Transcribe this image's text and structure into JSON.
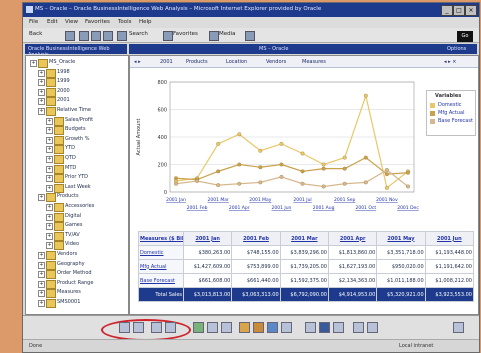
{
  "window": {
    "title": "MS – Oracle – Oracle BusinessIntelligence Web Analysis – Microsoft Internet Explorer provided by Oracle",
    "min": "_",
    "max": "□",
    "close": "×"
  },
  "menu": [
    "File",
    "Edit",
    "View",
    "Favorites",
    "Tools",
    "Help"
  ],
  "toolbar": {
    "back": "Back",
    "search": "Search",
    "favorites": "Favorites",
    "media": "Media",
    "address_btn": "Go"
  },
  "left_panel": {
    "header": "Oracle BusinessIntelligence Web Analysis"
  },
  "right_panel": {
    "header": "MS – Oracle",
    "right_label": "Options"
  },
  "tree": [
    {
      "label": "MS_Oracle",
      "level": 0
    },
    {
      "label": "1998",
      "level": 1
    },
    {
      "label": "1999",
      "level": 1
    },
    {
      "label": "2000",
      "level": 1
    },
    {
      "label": "2001",
      "level": 1
    },
    {
      "label": "Relative Time",
      "level": 1
    },
    {
      "label": "Sales/Profit",
      "level": 2
    },
    {
      "label": "Budgets",
      "level": 2
    },
    {
      "label": "Growth %",
      "level": 2
    },
    {
      "label": "YTD",
      "level": 2
    },
    {
      "label": "QTD",
      "level": 2
    },
    {
      "label": "MTD",
      "level": 2
    },
    {
      "label": "Prior YTD",
      "level": 2
    },
    {
      "label": "Last Week",
      "level": 2
    },
    {
      "label": "Products",
      "level": 1
    },
    {
      "label": "Accessories",
      "level": 2
    },
    {
      "label": "Digital",
      "level": 2
    },
    {
      "label": "Games",
      "level": 2
    },
    {
      "label": "TV/AV",
      "level": 2
    },
    {
      "label": "Video",
      "level": 2
    },
    {
      "label": "Vendors",
      "level": 1
    },
    {
      "label": "Geography",
      "level": 1
    },
    {
      "label": "Order Method",
      "level": 1
    },
    {
      "label": "Product Range",
      "level": 1
    },
    {
      "label": "Measures",
      "level": 1
    },
    {
      "label": "SMS0001",
      "level": 1
    }
  ],
  "dimbar": [
    "2001",
    "Products",
    "Location",
    "Vendors",
    "Measures"
  ],
  "chart_data": {
    "type": "line",
    "categories": [
      "2001 Jan",
      "2001 Feb",
      "2001 Mar",
      "2001 Apr",
      "2001 May",
      "2001 Jun",
      "2001 Jul",
      "2001 Aug",
      "2001 Sep",
      "2001 Oct",
      "2001 Nov",
      "2001 Dec"
    ],
    "ylim": [
      0,
      800
    ],
    "yticks": [
      "800",
      "600",
      "400",
      "200",
      "0"
    ],
    "ylabel": "Actual Amount",
    "grid": true,
    "legend": "right",
    "legend_title": "Variables",
    "series": [
      {
        "name": "Domestic",
        "color": "#e8c86a",
        "values": [
          80,
          100,
          350,
          420,
          300,
          350,
          280,
          200,
          250,
          700,
          30,
          150
        ]
      },
      {
        "name": "Mfg Actual",
        "color": "#c9a24c",
        "values": [
          100,
          90,
          150,
          200,
          180,
          200,
          150,
          170,
          170,
          250,
          130,
          140
        ]
      },
      {
        "name": "Base Forecast",
        "color": "#d6b890",
        "values": [
          60,
          80,
          50,
          60,
          70,
          110,
          60,
          40,
          60,
          70,
          160,
          40
        ]
      }
    ]
  },
  "table": {
    "corner": "Measures ($ Billions)",
    "cols": [
      "2001 Jan",
      "2001 Feb",
      "2001 Mar",
      "2001 Apr",
      "2001 May",
      "2001 Jun"
    ],
    "rows": [
      {
        "label": "Domestic",
        "values": [
          "$380,263.00",
          "$748,155.00",
          "$3,839,296.00",
          "$1,813,860.00",
          "$3,351,718.00",
          "$1,193,448.00"
        ]
      },
      {
        "label": "Mfg Actual",
        "values": [
          "$1,427,609.00",
          "$753,899.00",
          "$1,739,205.00",
          "$1,627,193.00",
          "$950,020.00",
          "$1,191,642.00"
        ]
      },
      {
        "label": "Base Forecast",
        "values": [
          "$661,608.00",
          "$661,440.00",
          "$1,592,375.00",
          "$2,134,363.00",
          "$1,011,188.00",
          "$1,008,212.00"
        ]
      }
    ],
    "total": {
      "label": "Total Sales",
      "values": [
        "$3,013,813.00",
        "$3,063,313.00",
        "$6,792,090.00",
        "$4,914,953.00",
        "$5,320,921.00",
        "$3,923,553.00"
      ]
    }
  },
  "status": {
    "left": "Done",
    "right": "Local intranet"
  }
}
